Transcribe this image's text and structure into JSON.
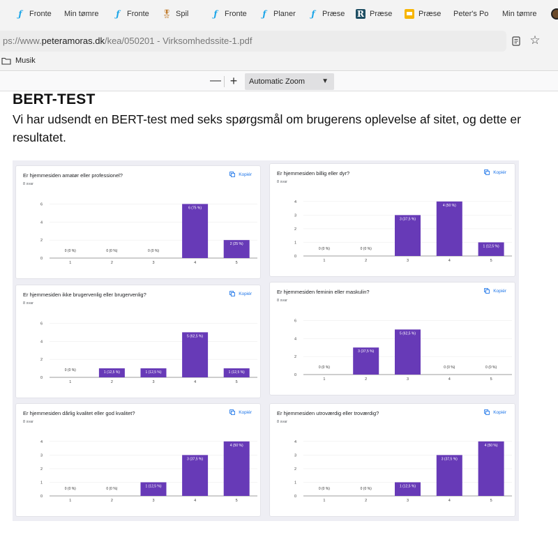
{
  "browser": {
    "bookmarks": [
      {
        "label": "Fronte",
        "icon": "frontend-icon"
      },
      {
        "label": "Min tømre",
        "icon": ""
      },
      {
        "label": "Fronte",
        "icon": "frontend-icon"
      },
      {
        "label": "Spil",
        "icon": "spil-icon"
      },
      {
        "label": "Fronte",
        "icon": "frontend-icon"
      },
      {
        "label": "Planer",
        "icon": "frontend-icon"
      },
      {
        "label": "Præse",
        "icon": "frontend-icon"
      },
      {
        "label": "Præse",
        "icon": "r-icon"
      },
      {
        "label": "Præse",
        "icon": "slides-icon"
      },
      {
        "label": "Peter's Po",
        "icon": ""
      },
      {
        "label": "Min tømre",
        "icon": ""
      }
    ],
    "url_prefix": "ps://www.",
    "url_domain": "peteramoras.dk",
    "url_path": "/kea/050201 - Virksomhedssite-1.pdf",
    "folder_label": "Musik"
  },
  "pdf_toolbar": {
    "zoom_out": "—",
    "zoom_in": "+",
    "zoom_label": "Automatic Zoom"
  },
  "document": {
    "title": "BERT-TEST",
    "paragraph": "Vi har udsendt en BERT-test med seks spørgsmål om brugerens oplevelse af sitet, og dette er resultatet."
  },
  "chart_data": [
    {
      "type": "bar",
      "title": "Er hjemmesiden amatør eller professionel?",
      "responses": "8 svar",
      "copy_label": "Kopiér",
      "categories": [
        "1",
        "2",
        "3",
        "4",
        "5"
      ],
      "values": [
        0,
        0,
        0,
        6,
        2
      ],
      "data_labels": [
        "0 (0 %)",
        "0 (0 %)",
        "0 (0 %)",
        "6 (75 %)",
        "2 (25 %)"
      ],
      "yticks": [
        0,
        2,
        4,
        6
      ],
      "ylim": [
        0,
        6.5
      ]
    },
    {
      "type": "bar",
      "title": "Er hjemmesiden billig eller dyr?",
      "responses": "8 svar",
      "copy_label": "Kopiér",
      "categories": [
        "1",
        "2",
        "3",
        "4",
        "5"
      ],
      "values": [
        0,
        0,
        3,
        4,
        1
      ],
      "data_labels": [
        "0 (0 %)",
        "0 (0 %)",
        "3 (37,5 %)",
        "4 (50 %)",
        "1 (12,5 %)"
      ],
      "yticks": [
        0,
        1,
        2,
        3,
        4
      ],
      "ylim": [
        0,
        4.3
      ]
    },
    {
      "type": "bar",
      "title": "Er hjemmesiden ikke brugervenlig eller brugervenlig?",
      "responses": "8 svar",
      "copy_label": "Kopiér",
      "categories": [
        "1",
        "2",
        "3",
        "4",
        "5"
      ],
      "values": [
        0,
        1,
        1,
        5,
        1
      ],
      "data_labels": [
        "0 (0 %)",
        "1 (12,5 %)",
        "1 (12,5 %)",
        "5 (62,5 %)",
        "1 (12,5 %)"
      ],
      "yticks": [
        0,
        2,
        4,
        6
      ],
      "ylim": [
        0,
        6.5
      ]
    },
    {
      "type": "bar",
      "title": "Er hjemmesiden feminin eller maskulin?",
      "responses": "8 svar",
      "copy_label": "Kopiér",
      "categories": [
        "1",
        "2",
        "3",
        "4",
        "5"
      ],
      "values": [
        0,
        3,
        5,
        0,
        0
      ],
      "data_labels": [
        "0 (0 %)",
        "3 (37,5 %)",
        "5 (62,5 %)",
        "0 (0 %)",
        "0 (0 %)"
      ],
      "yticks": [
        0,
        2,
        4,
        6
      ],
      "ylim": [
        0,
        6.5
      ]
    },
    {
      "type": "bar",
      "title": "Er hjemmesiden dårlig kvalitet eller god kvalitet?",
      "responses": "8 svar",
      "copy_label": "Kopiér",
      "categories": [
        "1",
        "2",
        "3",
        "4",
        "5"
      ],
      "values": [
        0,
        0,
        1,
        3,
        4
      ],
      "data_labels": [
        "0 (0 %)",
        "0 (0 %)",
        "1 (12,5 %)",
        "3 (37,5 %)",
        "4 (50 %)"
      ],
      "yticks": [
        0,
        1,
        2,
        3,
        4
      ],
      "ylim": [
        0,
        4.3
      ]
    },
    {
      "type": "bar",
      "title": "Er hjemmesiden utroværdig eller troværdig?",
      "responses": "8 svar",
      "copy_label": "Kopiér",
      "categories": [
        "1",
        "2",
        "3",
        "4",
        "5"
      ],
      "values": [
        0,
        0,
        1,
        3,
        4
      ],
      "data_labels": [
        "0 (0 %)",
        "0 (0 %)",
        "1 (12,5 %)",
        "3 (37,5 %)",
        "4 (50 %)"
      ],
      "yticks": [
        0,
        1,
        2,
        3,
        4
      ],
      "ylim": [
        0,
        4.3
      ]
    }
  ],
  "colors": {
    "bar": "#673ab7",
    "link": "#1a73e8",
    "grid": "#9e9e9e"
  }
}
